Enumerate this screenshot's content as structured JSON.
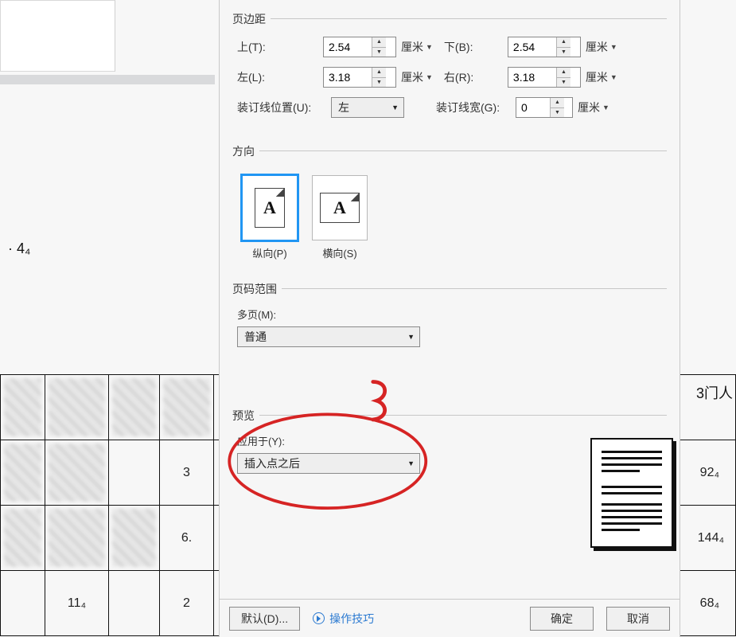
{
  "margins": {
    "legend": "页边距",
    "top": {
      "label": "上(T):",
      "value": "2.54",
      "unit": "厘米"
    },
    "bottom": {
      "label": "下(B):",
      "value": "2.54",
      "unit": "厘米"
    },
    "left": {
      "label": "左(L):",
      "value": "3.18",
      "unit": "厘米"
    },
    "right": {
      "label": "右(R):",
      "value": "3.18",
      "unit": "厘米"
    },
    "gutter_pos": {
      "label": "装订线位置(U):",
      "value": "左"
    },
    "gutter_width": {
      "label": "装订线宽(G):",
      "value": "0",
      "unit": "厘米"
    }
  },
  "orientation": {
    "legend": "方向",
    "portrait": "纵向(P)",
    "landscape": "横向(S)",
    "selected": "portrait"
  },
  "page_range": {
    "legend": "页码范围",
    "multi_label": "多页(M):",
    "multi_value": "普通"
  },
  "preview": {
    "legend": "预览",
    "apply_label": "应用于(Y):",
    "apply_value": "插入点之后"
  },
  "buttons": {
    "default": "默认(D)...",
    "tips": "操作技巧",
    "ok": "确定",
    "cancel": "取消"
  },
  "bg": {
    "side_text": "· 4₄",
    "corner_text": "3门人",
    "table": {
      "r1": {
        "c3": "3",
        "c_right": "92₄"
      },
      "r2": {
        "c3": "6.",
        "c_right": "144₄"
      },
      "r3": {
        "c1": "11₄",
        "c3": "2",
        "c_right": "68₄"
      }
    }
  }
}
